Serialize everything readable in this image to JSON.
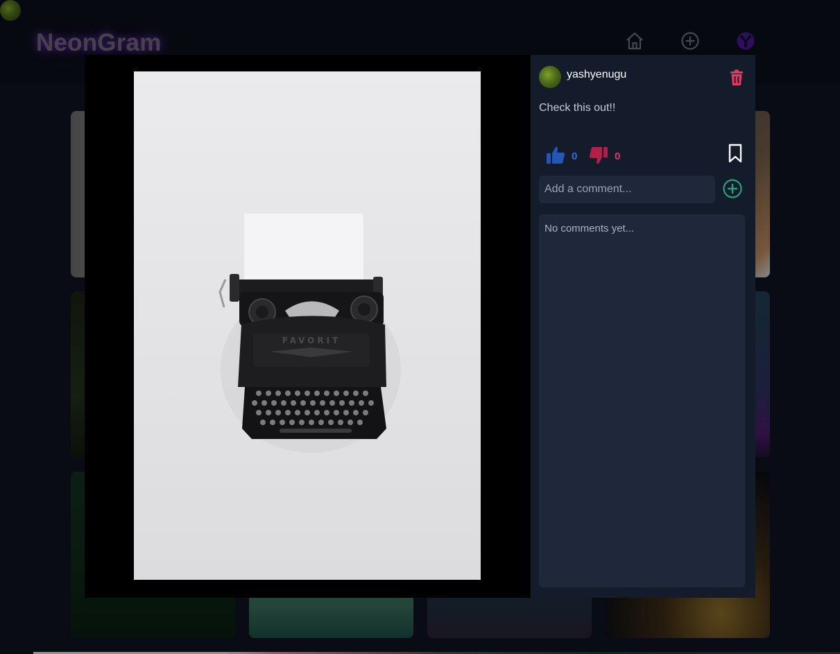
{
  "app": {
    "logo": "NeonGram"
  },
  "nav": {
    "home_icon": "home-icon",
    "add_icon": "plus-circle-icon",
    "explore_icon": "explore-icon",
    "profile_icon": "avatar"
  },
  "colors": {
    "page_bg": "#0e1320",
    "header_bg": "#0c0f1b",
    "panel_bg": "#141b2b",
    "input_bg": "#1f283a",
    "like": "#2f6fe0",
    "dislike": "#e2356c",
    "delete": "#f0335f",
    "add_comment": "#1ea57f",
    "explore_purple": "#5b1aa8"
  },
  "post": {
    "author": "yashyenugu",
    "caption": "Check this out!!",
    "likes": "0",
    "dislikes": "0",
    "comment_placeholder": "Add a comment...",
    "no_comments": "No comments yet..."
  }
}
